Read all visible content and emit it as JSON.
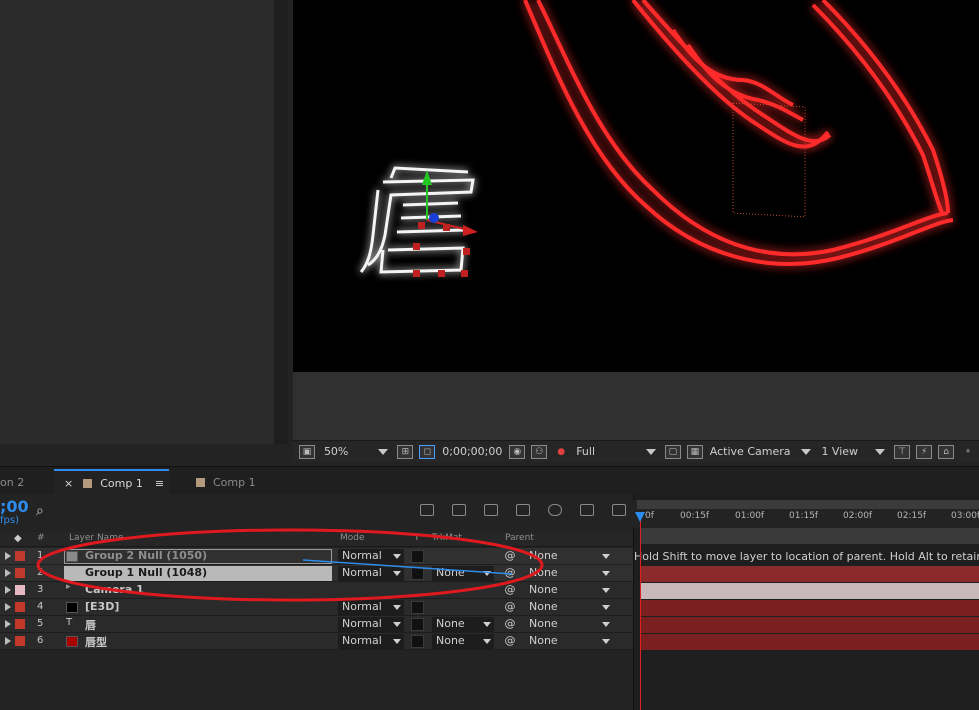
{
  "viewer": {
    "zoom": "50%",
    "timecode": "0;00;00;00",
    "resolution": "Full",
    "camera": "Active Camera",
    "views": "1 View"
  },
  "tabs": [
    {
      "label": "on 2"
    },
    {
      "label": "Comp 1",
      "close": "×",
      "menu": "≡"
    },
    {
      "label": "Comp 1"
    }
  ],
  "timeline": {
    "timecode": ";00",
    "fps_label": "fps)",
    "search_placeholder": "⌕",
    "columns": {
      "num": "#",
      "layer_name": "Layer Name",
      "mode": "Mode",
      "t": "T",
      "trkmat": "TrkMat",
      "parent": "Parent"
    },
    "ruler_ticks": [
      "0f",
      "00:15f",
      "01:00f",
      "01:15f",
      "02:00f",
      "02:15f",
      "03:00f"
    ],
    "hint": "Hold Shift to move layer to location of parent. Hold Alt to retain ch",
    "layers": [
      {
        "num": "1",
        "name": "Group 2 Null (1050)",
        "label_color": "#c0392b",
        "type_color": "#8a8a8a",
        "mode": "Normal",
        "trkmat": "",
        "parent": "None",
        "bar_color": "#7a2020"
      },
      {
        "num": "2",
        "name": "Group 1 Null (1048)",
        "label_color": "#c0392b",
        "type_color": "#ffffff",
        "mode": "Normal",
        "trkmat": "None",
        "parent": "None",
        "bar_color": "#8a2a2a"
      },
      {
        "num": "3",
        "name": "Camera 1",
        "label_color": "#e6b8c4",
        "type_color": "",
        "mode": "",
        "trkmat": "",
        "parent": "None",
        "bar_color": "#c9b8bb"
      },
      {
        "num": "4",
        "name": "[E3D]",
        "label_color": "#c0392b",
        "type_color": "#000000",
        "mode": "Normal",
        "trkmat": "",
        "parent": "None",
        "bar_color": "#7a2020"
      },
      {
        "num": "5",
        "name": "唇",
        "label_color": "#c0392b",
        "type_color": "",
        "mode": "Normal",
        "trkmat": "None",
        "parent": "None",
        "bar_color": "#7a2020"
      },
      {
        "num": "6",
        "name": "唇型",
        "label_color": "#c0392b",
        "type_color": "#aa0000",
        "mode": "Normal",
        "trkmat": "None",
        "parent": "None",
        "bar_color": "#7a2020"
      }
    ]
  },
  "colors": {
    "accent": "#2d8ceb",
    "annotation": "#e0191f",
    "neon": "#ff2a2a"
  }
}
